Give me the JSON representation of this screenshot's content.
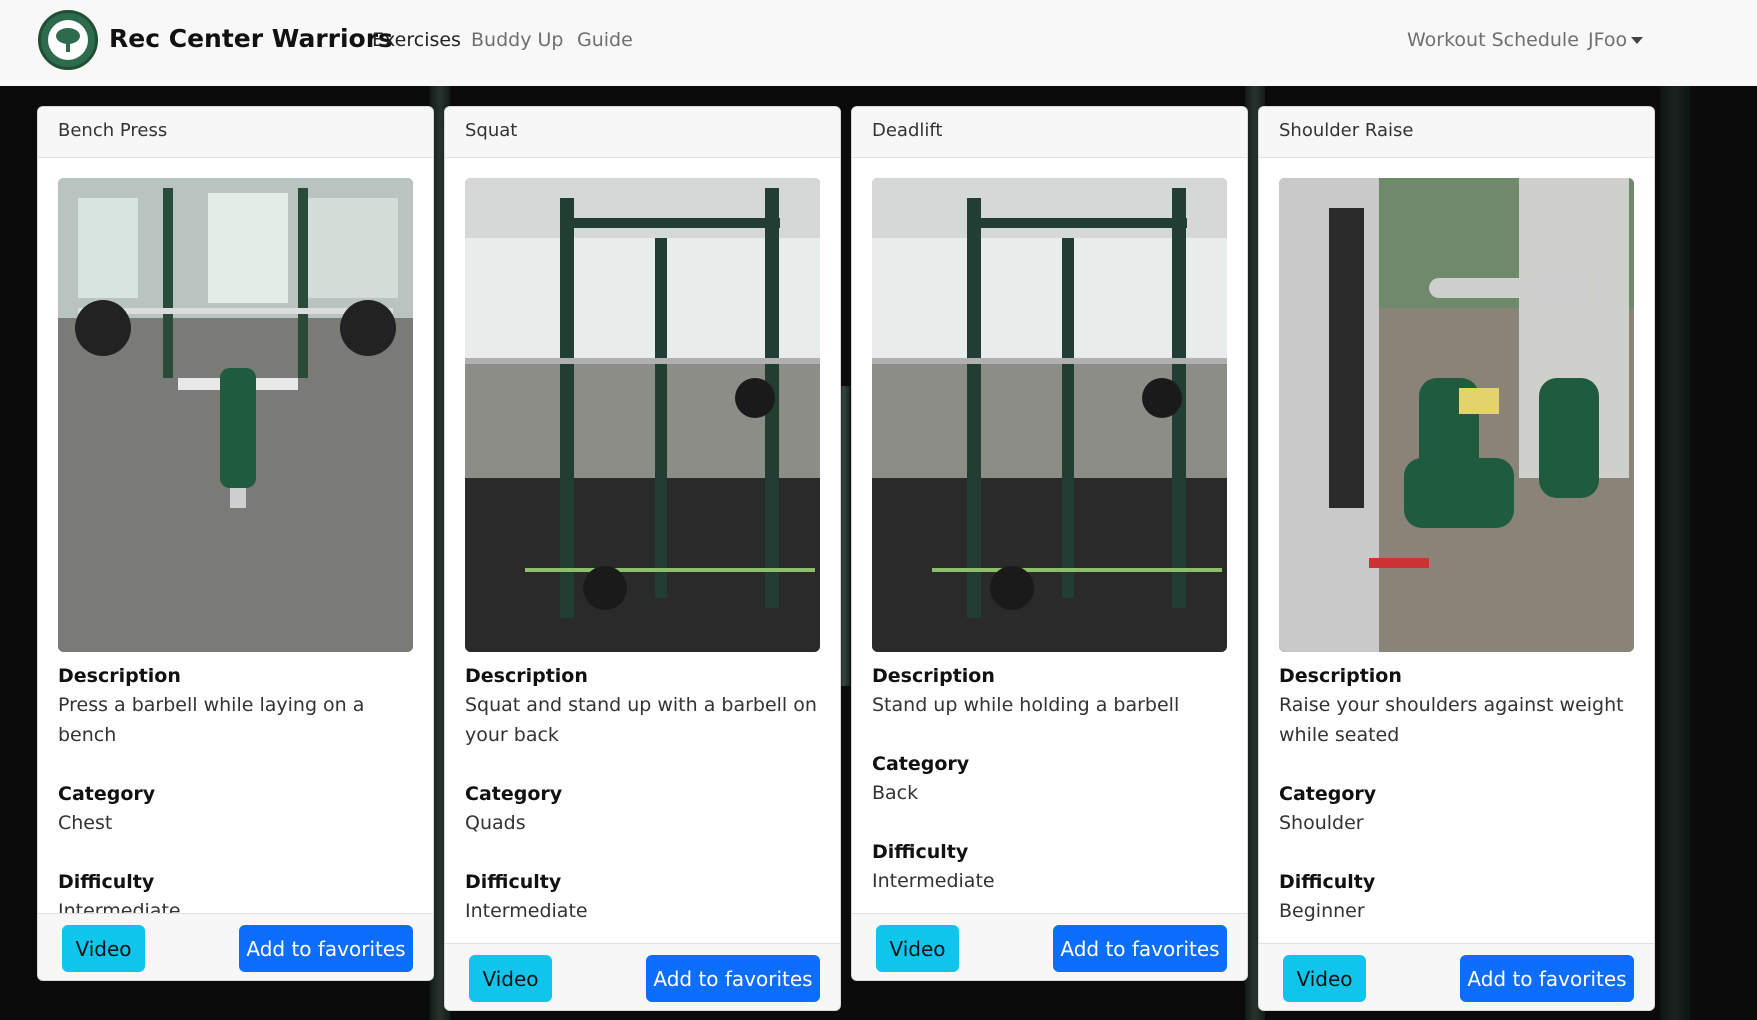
{
  "nav": {
    "brand": "Rec Center Warriors",
    "links": [
      "Exercises",
      "Buddy Up",
      "Guide"
    ],
    "right_links": [
      "Workout Schedule",
      "JFoo"
    ]
  },
  "cards": [
    {
      "title": "Bench Press",
      "description_label": "Description",
      "description": "Press a barbell while laying on a bench",
      "category_label": "Category",
      "category": "Chest",
      "difficulty_label": "Difficulty",
      "difficulty": "Intermediate",
      "video_label": "Video",
      "fav_label": "Add to favorites"
    },
    {
      "title": "Squat",
      "description_label": "Description",
      "description": "Squat and stand up with a barbell on your back",
      "category_label": "Category",
      "category": "Quads",
      "difficulty_label": "Difficulty",
      "difficulty": "Intermediate",
      "video_label": "Video",
      "fav_label": "Add to favorites"
    },
    {
      "title": "Deadlift",
      "description_label": "Description",
      "description": "Stand up while holding a barbell",
      "category_label": "Category",
      "category": "Back",
      "difficulty_label": "Difficulty",
      "difficulty": "Intermediate",
      "video_label": "Video",
      "fav_label": "Add to favorites"
    },
    {
      "title": "Shoulder Raise",
      "description_label": "Description",
      "description": "Raise your shoulders against weight while seated",
      "category_label": "Category",
      "category": "Shoulder",
      "difficulty_label": "Difficulty",
      "difficulty": "Beginner",
      "video_label": "Video",
      "fav_label": "Add to favorites"
    }
  ],
  "colors": {
    "video_button": "#10c5ec",
    "favorites_button": "#0d6efd",
    "navbar_bg": "#f8f8f8",
    "logo_green": "#2e6b4c"
  },
  "icons": {
    "logo": "tree-seal-icon",
    "dropdown": "caret-down-icon"
  }
}
